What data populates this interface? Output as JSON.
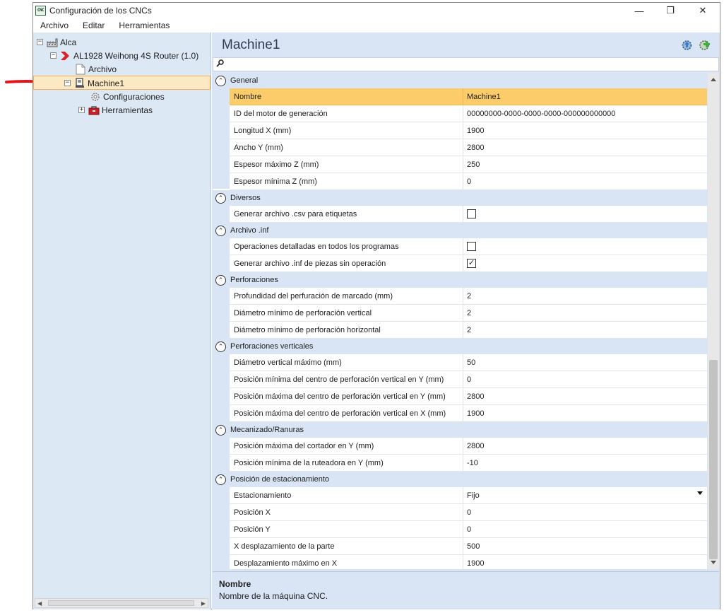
{
  "window": {
    "title": "Configuración de los CNCs",
    "app_icon_text": "CNC",
    "controls": {
      "minimize": "—",
      "restore": "❐",
      "close": "✕"
    }
  },
  "menubar": [
    "Archivo",
    "Editar",
    "Herramientas"
  ],
  "tree": {
    "root": "Alca",
    "router": "AL1928 Weihong 4S Router (1.0)",
    "archivo": "Archivo",
    "machine": "Machine1",
    "configuraciones": "Configuraciones",
    "herramientas": "Herramientas"
  },
  "panel": {
    "title": "Machine1",
    "search_placeholder": ""
  },
  "categories": {
    "general": "General",
    "diversos": "Diversos",
    "archivo_inf": "Archivo .inf",
    "perforaciones": "Perforaciones",
    "perf_verticales": "Perforaciones verticales",
    "mecanizado": "Mecanizado/Ranuras",
    "estacionamiento": "Posición de estacionamiento"
  },
  "properties": {
    "nombre": {
      "name": "Nombre",
      "value": "Machine1"
    },
    "id_motor": {
      "name": "ID del motor de generación",
      "value": "00000000-0000-0000-0000-000000000000"
    },
    "longitud_x": {
      "name": "Longitud X (mm)",
      "value": "1900"
    },
    "ancho_y": {
      "name": "Ancho Y (mm)",
      "value": "2800"
    },
    "espesor_max_z": {
      "name": "Espesor máximo Z (mm)",
      "value": "250"
    },
    "espesor_min_z": {
      "name": "Espesor mínima Z (mm)",
      "value": "0"
    },
    "csv_etiquetas": {
      "name": "Generar archivo .csv para etiquetas",
      "checked": false
    },
    "ops_detalladas": {
      "name": "Operaciones detalladas en todos los programas",
      "checked": false
    },
    "inf_piezas": {
      "name": "Generar archivo .inf de piezas sin operación",
      "checked": true
    },
    "profundidad_marcado": {
      "name": "Profundidad del perfuración de marcado (mm)",
      "value": "2"
    },
    "diam_min_vertical": {
      "name": "Diámetro mínimo de perforación vertical",
      "value": "2"
    },
    "diam_min_horizontal": {
      "name": "Diámetro mínimo de perforación horizontal",
      "value": "2"
    },
    "diam_vert_max": {
      "name": "Diámetro vertical máximo (mm)",
      "value": "50"
    },
    "pos_min_centro_y": {
      "name": "Posición mínima del centro de perforación vertical en Y (mm)",
      "value": "0"
    },
    "pos_max_centro_y": {
      "name": "Posición máxima del centro de perforación vertical en Y (mm)",
      "value": "2800"
    },
    "pos_max_centro_x": {
      "name": "Posición máxima del centro de perforación vertical en X (mm)",
      "value": "1900"
    },
    "pos_max_cortador_y": {
      "name": "Posición máxima del cortador en Y (mm)",
      "value": "2800"
    },
    "pos_min_ruteadora_y": {
      "name": "Posición mínima de la ruteadora en Y (mm)",
      "value": "-10"
    },
    "estacionamiento": {
      "name": "Estacionamiento",
      "value": "Fijo"
    },
    "posicion_x": {
      "name": "Posición X",
      "value": "0"
    },
    "posicion_y": {
      "name": "Posición Y",
      "value": "0"
    },
    "x_desplazamiento": {
      "name": "X desplazamiento de la parte",
      "value": "500"
    },
    "desplazamiento_max_x": {
      "name": "Desplazamiento máximo en X",
      "value": "1900"
    }
  },
  "description": {
    "title": "Nombre",
    "text": "Nombre de la máquina CNC."
  },
  "colors": {
    "panel_bg": "#d9e5f4",
    "selected_row": "#fccc6b",
    "tree_selected": "#fde8c4",
    "annotation_arrow": "#e8141c"
  },
  "icons": {
    "header_left": "gear-upload-icon",
    "header_right": "gear-add-icon",
    "search": "key-search-icon"
  }
}
